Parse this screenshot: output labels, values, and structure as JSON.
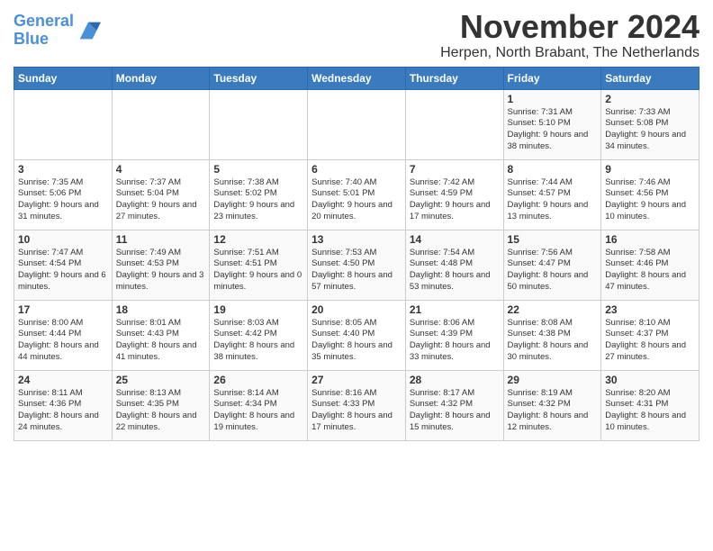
{
  "logo": {
    "line1": "General",
    "line2": "Blue"
  },
  "title": "November 2024",
  "subtitle": "Herpen, North Brabant, The Netherlands",
  "weekdays": [
    "Sunday",
    "Monday",
    "Tuesday",
    "Wednesday",
    "Thursday",
    "Friday",
    "Saturday"
  ],
  "weeks": [
    [
      {
        "day": "",
        "info": ""
      },
      {
        "day": "",
        "info": ""
      },
      {
        "day": "",
        "info": ""
      },
      {
        "day": "",
        "info": ""
      },
      {
        "day": "",
        "info": ""
      },
      {
        "day": "1",
        "info": "Sunrise: 7:31 AM\nSunset: 5:10 PM\nDaylight: 9 hours and 38 minutes."
      },
      {
        "day": "2",
        "info": "Sunrise: 7:33 AM\nSunset: 5:08 PM\nDaylight: 9 hours and 34 minutes."
      }
    ],
    [
      {
        "day": "3",
        "info": "Sunrise: 7:35 AM\nSunset: 5:06 PM\nDaylight: 9 hours and 31 minutes."
      },
      {
        "day": "4",
        "info": "Sunrise: 7:37 AM\nSunset: 5:04 PM\nDaylight: 9 hours and 27 minutes."
      },
      {
        "day": "5",
        "info": "Sunrise: 7:38 AM\nSunset: 5:02 PM\nDaylight: 9 hours and 23 minutes."
      },
      {
        "day": "6",
        "info": "Sunrise: 7:40 AM\nSunset: 5:01 PM\nDaylight: 9 hours and 20 minutes."
      },
      {
        "day": "7",
        "info": "Sunrise: 7:42 AM\nSunset: 4:59 PM\nDaylight: 9 hours and 17 minutes."
      },
      {
        "day": "8",
        "info": "Sunrise: 7:44 AM\nSunset: 4:57 PM\nDaylight: 9 hours and 13 minutes."
      },
      {
        "day": "9",
        "info": "Sunrise: 7:46 AM\nSunset: 4:56 PM\nDaylight: 9 hours and 10 minutes."
      }
    ],
    [
      {
        "day": "10",
        "info": "Sunrise: 7:47 AM\nSunset: 4:54 PM\nDaylight: 9 hours and 6 minutes."
      },
      {
        "day": "11",
        "info": "Sunrise: 7:49 AM\nSunset: 4:53 PM\nDaylight: 9 hours and 3 minutes."
      },
      {
        "day": "12",
        "info": "Sunrise: 7:51 AM\nSunset: 4:51 PM\nDaylight: 9 hours and 0 minutes."
      },
      {
        "day": "13",
        "info": "Sunrise: 7:53 AM\nSunset: 4:50 PM\nDaylight: 8 hours and 57 minutes."
      },
      {
        "day": "14",
        "info": "Sunrise: 7:54 AM\nSunset: 4:48 PM\nDaylight: 8 hours and 53 minutes."
      },
      {
        "day": "15",
        "info": "Sunrise: 7:56 AM\nSunset: 4:47 PM\nDaylight: 8 hours and 50 minutes."
      },
      {
        "day": "16",
        "info": "Sunrise: 7:58 AM\nSunset: 4:46 PM\nDaylight: 8 hours and 47 minutes."
      }
    ],
    [
      {
        "day": "17",
        "info": "Sunrise: 8:00 AM\nSunset: 4:44 PM\nDaylight: 8 hours and 44 minutes."
      },
      {
        "day": "18",
        "info": "Sunrise: 8:01 AM\nSunset: 4:43 PM\nDaylight: 8 hours and 41 minutes."
      },
      {
        "day": "19",
        "info": "Sunrise: 8:03 AM\nSunset: 4:42 PM\nDaylight: 8 hours and 38 minutes."
      },
      {
        "day": "20",
        "info": "Sunrise: 8:05 AM\nSunset: 4:40 PM\nDaylight: 8 hours and 35 minutes."
      },
      {
        "day": "21",
        "info": "Sunrise: 8:06 AM\nSunset: 4:39 PM\nDaylight: 8 hours and 33 minutes."
      },
      {
        "day": "22",
        "info": "Sunrise: 8:08 AM\nSunset: 4:38 PM\nDaylight: 8 hours and 30 minutes."
      },
      {
        "day": "23",
        "info": "Sunrise: 8:10 AM\nSunset: 4:37 PM\nDaylight: 8 hours and 27 minutes."
      }
    ],
    [
      {
        "day": "24",
        "info": "Sunrise: 8:11 AM\nSunset: 4:36 PM\nDaylight: 8 hours and 24 minutes."
      },
      {
        "day": "25",
        "info": "Sunrise: 8:13 AM\nSunset: 4:35 PM\nDaylight: 8 hours and 22 minutes."
      },
      {
        "day": "26",
        "info": "Sunrise: 8:14 AM\nSunset: 4:34 PM\nDaylight: 8 hours and 19 minutes."
      },
      {
        "day": "27",
        "info": "Sunrise: 8:16 AM\nSunset: 4:33 PM\nDaylight: 8 hours and 17 minutes."
      },
      {
        "day": "28",
        "info": "Sunrise: 8:17 AM\nSunset: 4:32 PM\nDaylight: 8 hours and 15 minutes."
      },
      {
        "day": "29",
        "info": "Sunrise: 8:19 AM\nSunset: 4:32 PM\nDaylight: 8 hours and 12 minutes."
      },
      {
        "day": "30",
        "info": "Sunrise: 8:20 AM\nSunset: 4:31 PM\nDaylight: 8 hours and 10 minutes."
      }
    ]
  ]
}
